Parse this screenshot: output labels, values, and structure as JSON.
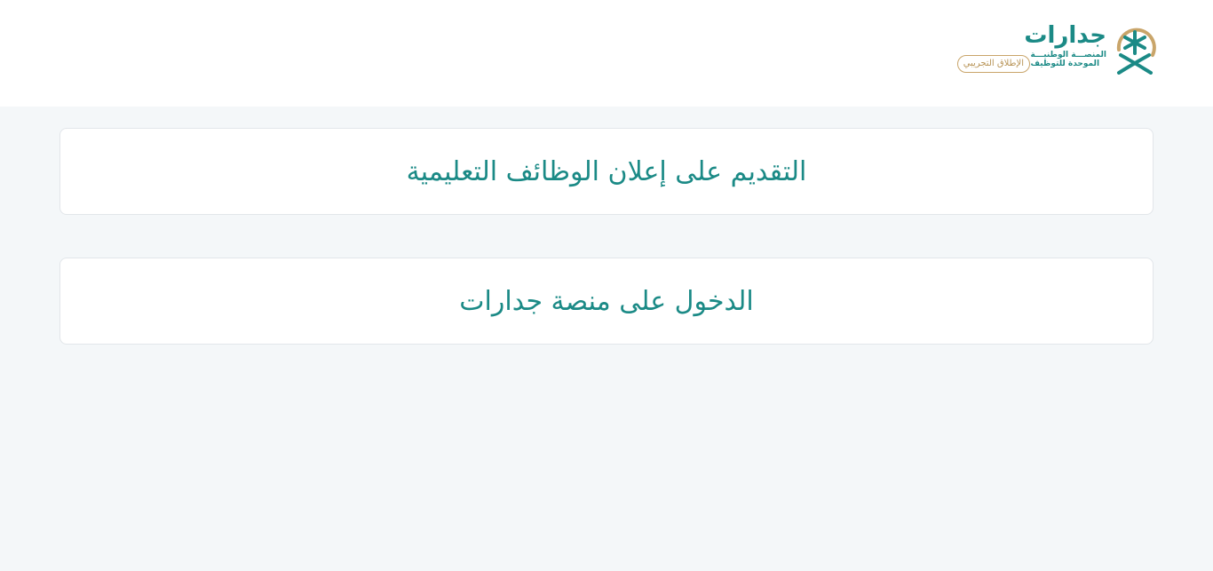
{
  "header": {
    "brand_name": "جدارات",
    "brand_subtitle_line1": "المنصـــة الوطنيـــة",
    "brand_subtitle_line2": "الموحدة للتوظيف",
    "beta_badge": "الإطلاق التجريبي",
    "emblem_icon": "palm-swords-emblem-icon"
  },
  "main": {
    "cards": [
      {
        "label": "التقديم على إعلان الوظائف التعليمية"
      },
      {
        "label": "الدخول على منصة جدارات"
      }
    ]
  },
  "colors": {
    "brand_teal": "#1b8a86",
    "brand_gold": "#c9a56a",
    "page_bg": "#f4f7f9",
    "card_border": "#e2e6ea"
  }
}
